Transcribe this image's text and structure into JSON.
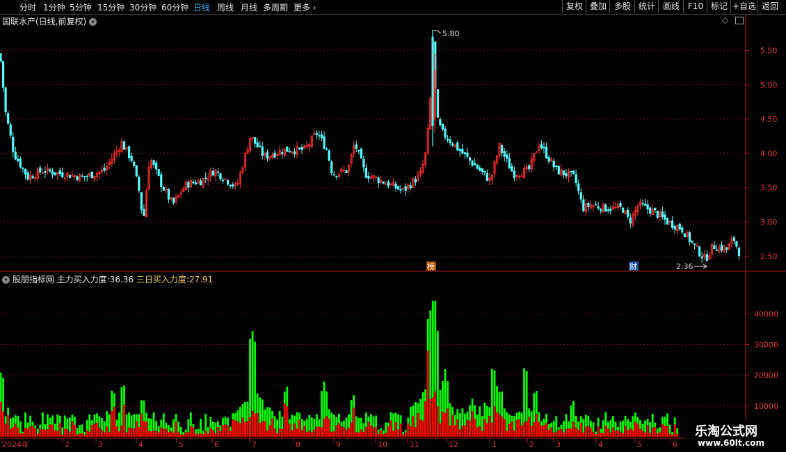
{
  "toolbar": {
    "periods": [
      "分时",
      "1分钟",
      "5分钟",
      "15分钟",
      "30分钟",
      "60分钟",
      "日线",
      "周线",
      "月线",
      "多周期",
      "更多"
    ],
    "active_period": "日线",
    "right_buttons": [
      "复权",
      "叠加",
      "多股",
      "统计",
      "画线",
      "F10",
      "标记",
      "+自选",
      "返回"
    ]
  },
  "price_panel": {
    "title": "国联水产(日线,前复权)",
    "y_ticks": [
      "5.50",
      "5.00",
      "4.50",
      "4.00",
      "3.50",
      "3.00",
      "2.50"
    ],
    "high_label": "5.80",
    "low_label": "2.36",
    "markers": [
      "榜",
      "财"
    ]
  },
  "indicator_panel": {
    "source": "股朋指标网",
    "main_label": "主力买入力度:",
    "main_value": "36.36",
    "three_day_label": "三日买入力度:",
    "three_day_value": "27.91",
    "y_ticks": [
      "40000",
      "30000",
      "20000",
      "10000"
    ]
  },
  "x_axis": {
    "labels": [
      "2024年",
      "2",
      "3",
      "4",
      "5",
      "6",
      "7",
      "8",
      "9",
      "10",
      "11",
      "12",
      "1",
      "2",
      "3",
      "4",
      "5",
      "6"
    ]
  },
  "watermark": {
    "main": "乐淘公式网",
    "url": "www.60lt.com"
  },
  "colors": {
    "up": "#ff3030",
    "down": "#54ffff",
    "bar_green": "#00ff00",
    "bar_red": "#ff0000",
    "axis": "#b01818",
    "active": "#39b8ff",
    "accent_yellow": "#f0d060"
  },
  "chart_data": {
    "type": "candlestick",
    "x_range": [
      "2024-01",
      "2025-06"
    ],
    "price_ylim": [
      2.3,
      5.85
    ],
    "price_series": [
      {
        "month": "2024-01",
        "close": 4.3
      },
      {
        "month": "2024-02",
        "close": 3.7
      },
      {
        "month": "2024-03",
        "close": 3.9
      },
      {
        "month": "2024-04",
        "close": 3.3
      },
      {
        "month": "2024-05",
        "close": 3.5
      },
      {
        "month": "2024-06",
        "close": 3.6
      },
      {
        "month": "2024-07",
        "close": 3.95
      },
      {
        "month": "2024-08",
        "close": 4.05
      },
      {
        "month": "2024-09",
        "close": 3.65
      },
      {
        "month": "2024-10",
        "close": 3.6
      },
      {
        "month": "2024-11",
        "close": 4.4
      },
      {
        "month": "2024-12",
        "close": 3.9
      },
      {
        "month": "2025-01",
        "close": 3.9
      },
      {
        "month": "2025-02",
        "close": 4.0
      },
      {
        "month": "2025-03",
        "close": 3.7
      },
      {
        "month": "2025-04",
        "close": 3.15
      },
      {
        "month": "2025-05",
        "close": 3.1
      },
      {
        "month": "2025-06",
        "close": 2.6
      }
    ],
    "price_high": 5.8,
    "price_low": 2.36,
    "indicator_ylim": [
      0,
      48000
    ],
    "indicator_peaks": [
      {
        "month": "2024-07",
        "value": 36400
      },
      {
        "month": "2024-11",
        "value": 48500
      }
    ]
  }
}
